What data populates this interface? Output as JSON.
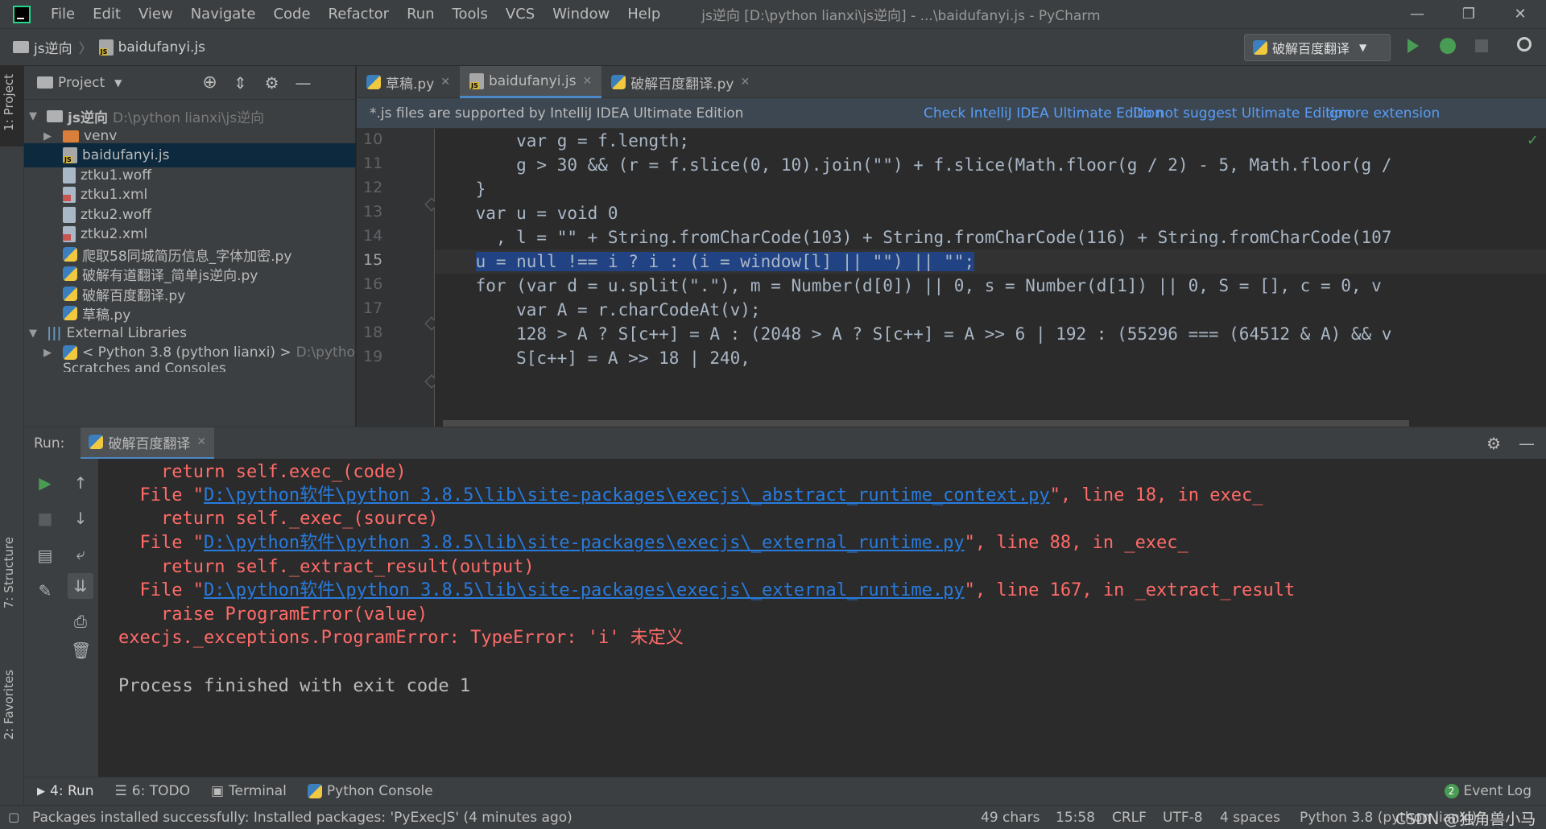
{
  "titlebar": {
    "menu": [
      "File",
      "Edit",
      "View",
      "Navigate",
      "Code",
      "Refactor",
      "Run",
      "Tools",
      "VCS",
      "Window",
      "Help"
    ],
    "title": "js逆向 [D:\\python lianxi\\js逆向] - ...\\baidufanyi.js - PyCharm",
    "minimize": "—",
    "maximize": "❐",
    "close": "✕"
  },
  "navbar": {
    "crumb_project": "js逆向",
    "crumb_file": "baidufanyi.js",
    "run_config": "破解百度翻译",
    "run_config_arrow": "▼"
  },
  "project": {
    "header": "Project",
    "header_arrow": "▼",
    "root_name": "js逆向",
    "root_path": "D:\\python lianxi\\js逆向",
    "items": [
      "venv",
      "baidufanyi.js",
      "ztku1.woff",
      "ztku1.xml",
      "ztku2.woff",
      "ztku2.xml",
      "爬取58同城简历信息_字体加密.py",
      "破解有道翻译_简单js逆向.py",
      "破解百度翻译.py",
      "草稿.py"
    ],
    "external_libraries": "External Libraries",
    "python_sdk": "< Python 3.8 (python lianxi) >",
    "python_sdk_path": "D:\\pytho",
    "scratches": "Scratches and Consoles"
  },
  "editor": {
    "tabs": [
      "草稿.py",
      "baidufanyi.js",
      "破解百度翻译.py"
    ],
    "banner_text": "*.js files are supported by IntelliJ IDEA Ultimate Edition",
    "banner_link1": "Check IntelliJ IDEA Ultimate Edition",
    "banner_link2": "Do not suggest Ultimate Edition",
    "banner_link3": "Ignore extension",
    "line_numbers": [
      "10",
      "11",
      "12",
      "13",
      "14",
      "15",
      "16",
      "17",
      "18",
      "19"
    ],
    "code": {
      "l10": "        var g = f.length;",
      "l11": "        g > 30 && (r = f.slice(0, 10).join(\"\") + f.slice(Math.floor(g / 2) - 5, Math.floor(g /",
      "l12": "    }",
      "l13": "    var u = void 0",
      "l14": "      , l = \"\" + String.fromCharCode(103) + String.fromCharCode(116) + String.fromCharCode(107",
      "l15": "u = null !== i ? i : (i = window[l] || \"\") || \"\";",
      "l16": "    for (var d = u.split(\".\"), m = Number(d[0]) || 0, s = Number(d[1]) || 0, S = [], c = 0, v",
      "l17": "        var A = r.charCodeAt(v);",
      "l18": "        128 > A ? S[c++] = A : (2048 > A ? S[c++] = A >> 6 | 192 : (55296 === (64512 & A) && v",
      "l19": "        S[c++] = A >> 18 | 240,"
    }
  },
  "run": {
    "label": "Run:",
    "tab": "破解百度翻译",
    "console": {
      "line1": "    return self.exec_(code)",
      "line2_pre": "  File \"",
      "line2_link": "D:\\python软件\\python 3.8.5\\lib\\site-packages\\execjs\\_abstract_runtime_context.py",
      "line2_post": "\", line 18, in exec_",
      "line3": "    return self._exec_(source)",
      "line4_pre": "  File \"",
      "line4_link": "D:\\python软件\\python 3.8.5\\lib\\site-packages\\execjs\\_external_runtime.py",
      "line4_post": "\", line 88, in _exec_",
      "line5": "    return self._extract_result(output)",
      "line6_pre": "  File \"",
      "line6_link": "D:\\python软件\\python 3.8.5\\lib\\site-packages\\execjs\\_external_runtime.py",
      "line6_post": "\", line 167, in _extract_result",
      "line7": "    raise ProgramError(value)",
      "line8": "execjs._exceptions.ProgramError: TypeError: 'i' 未定义",
      "line9": "Process finished with exit code 1"
    }
  },
  "tooltabs": {
    "run": "4: Run",
    "todo": "6: TODO",
    "terminal": "Terminal",
    "python_console": "Python Console",
    "event_log": "Event Log",
    "event_count": "2"
  },
  "sidestrip": {
    "project": "1: Project",
    "structure": "7: Structure",
    "favorites": "2: Favorites"
  },
  "statusbar": {
    "message": "Packages installed successfully: Installed packages: 'PyExecJS' (4 minutes ago)",
    "chars": "49 chars",
    "position": "15:58",
    "line_sep": "CRLF",
    "encoding": "UTF-8",
    "indent": "4 spaces",
    "interpreter": "Python 3.8 (python lianxi)",
    "watermark": "CSDN @独角兽小马"
  },
  "colors": {
    "accent": "#4a88c7",
    "error": "#ff6b68",
    "link": "#287bde",
    "selection": "#214283",
    "run_green": "#499c54"
  }
}
